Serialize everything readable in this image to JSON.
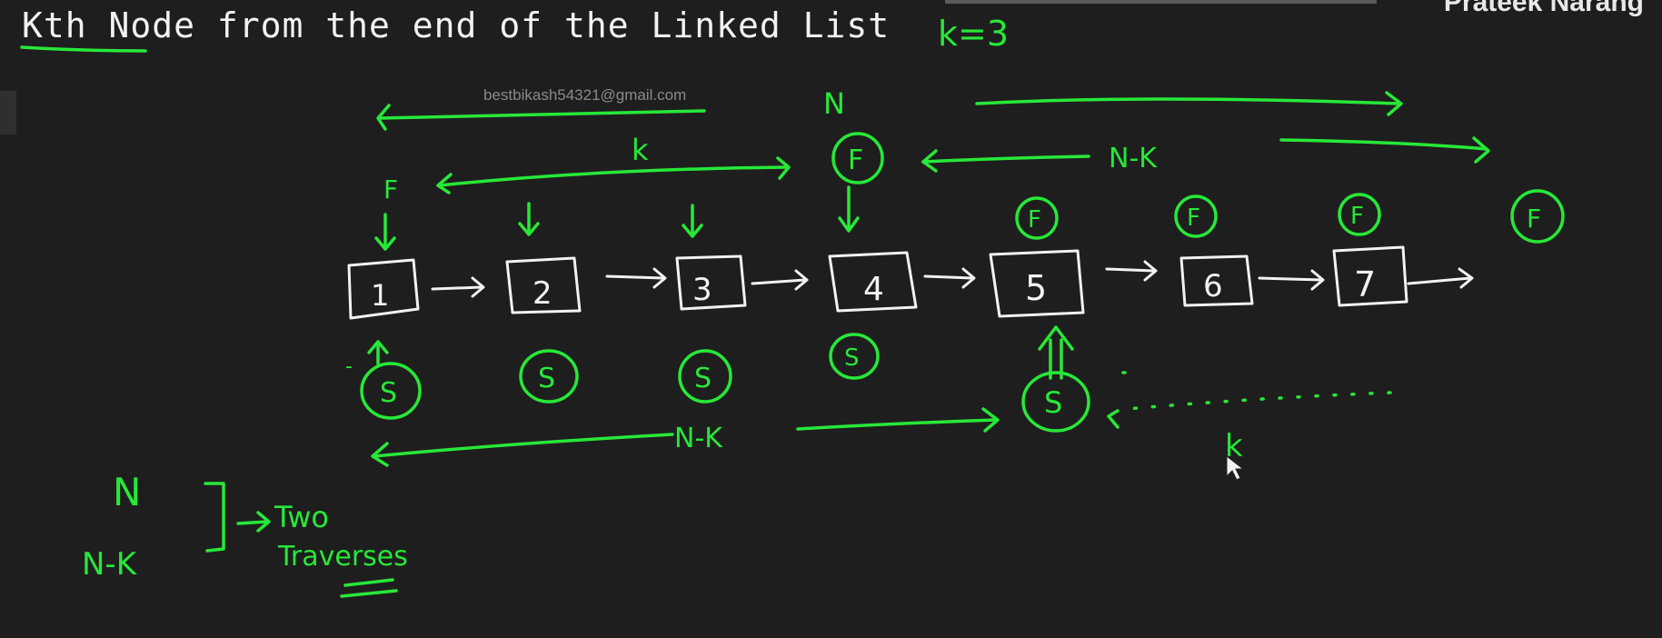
{
  "title": "Kth Node from the end of the Linked List",
  "author": "Prateek Narang",
  "watermark_email": "bestbikash54321@gmail.com",
  "whiteboard": {
    "k_value_label": "k=3",
    "n_top_label": "N",
    "k_span_label": "k",
    "n_minus_k_top_label": "N-K",
    "n_minus_k_bottom_label": "N-K",
    "k_bottom_label": "k",
    "fast_pointer_label": "F",
    "slow_pointer_label": "S",
    "node_values": [
      "1",
      "2",
      "3",
      "4",
      "5",
      "6",
      "7"
    ],
    "notes": {
      "n_label": "N",
      "n_minus_k_label": "N-K",
      "two_label": "Two",
      "traverses_label": "Traverses"
    }
  },
  "colors": {
    "background": "#1e1e1e",
    "ink_green": "#27e838",
    "ink_white": "#f2f2f2"
  }
}
